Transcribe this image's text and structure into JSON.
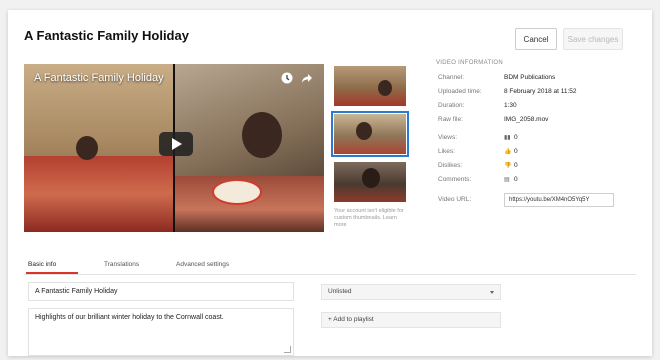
{
  "header": {
    "title": "A Fantastic Family Holiday",
    "cancel_label": "Cancel",
    "save_label": "Save changes"
  },
  "video": {
    "overlay_title": "A Fantastic Family Holiday",
    "icons": [
      "clock-icon",
      "share-icon",
      "play-icon"
    ]
  },
  "thumbnails": {
    "count": 3,
    "selected_index": 1,
    "note": "Your account isn't eligible for custom thumbnails. Learn more"
  },
  "info": {
    "section_label": "VIDEO INFORMATION",
    "rows": [
      {
        "label": "Channel:",
        "value": "BDM Publications"
      },
      {
        "label": "Uploaded time:",
        "value": "8 February 2018 at 11:52"
      },
      {
        "label": "Duration:",
        "value": "1:30"
      },
      {
        "label": "Raw file:",
        "value": "IMG_2058.mov"
      },
      {
        "label": "Views:",
        "value": "0"
      },
      {
        "label": "Likes:",
        "value": "0"
      },
      {
        "label": "Dislikes:",
        "value": "0"
      },
      {
        "label": "Comments:",
        "value": "0"
      }
    ],
    "video_url_label": "Video URL:",
    "video_url": "https://youtu.be/XM4nO5Yq5Y"
  },
  "tabs": [
    {
      "label": "Basic info",
      "active": true
    },
    {
      "label": "Translations",
      "active": false
    },
    {
      "label": "Advanced settings",
      "active": false
    }
  ],
  "form": {
    "title_value": "A Fantastic Family Holiday",
    "description_value": "Highlights of our brilliant winter holiday to the Cornwall coast.",
    "privacy_value": "Unlisted",
    "playlist_label": "+ Add to playlist"
  },
  "colors": {
    "accent_red": "#d9342b",
    "selected_thumb": "#2a7ad4"
  }
}
